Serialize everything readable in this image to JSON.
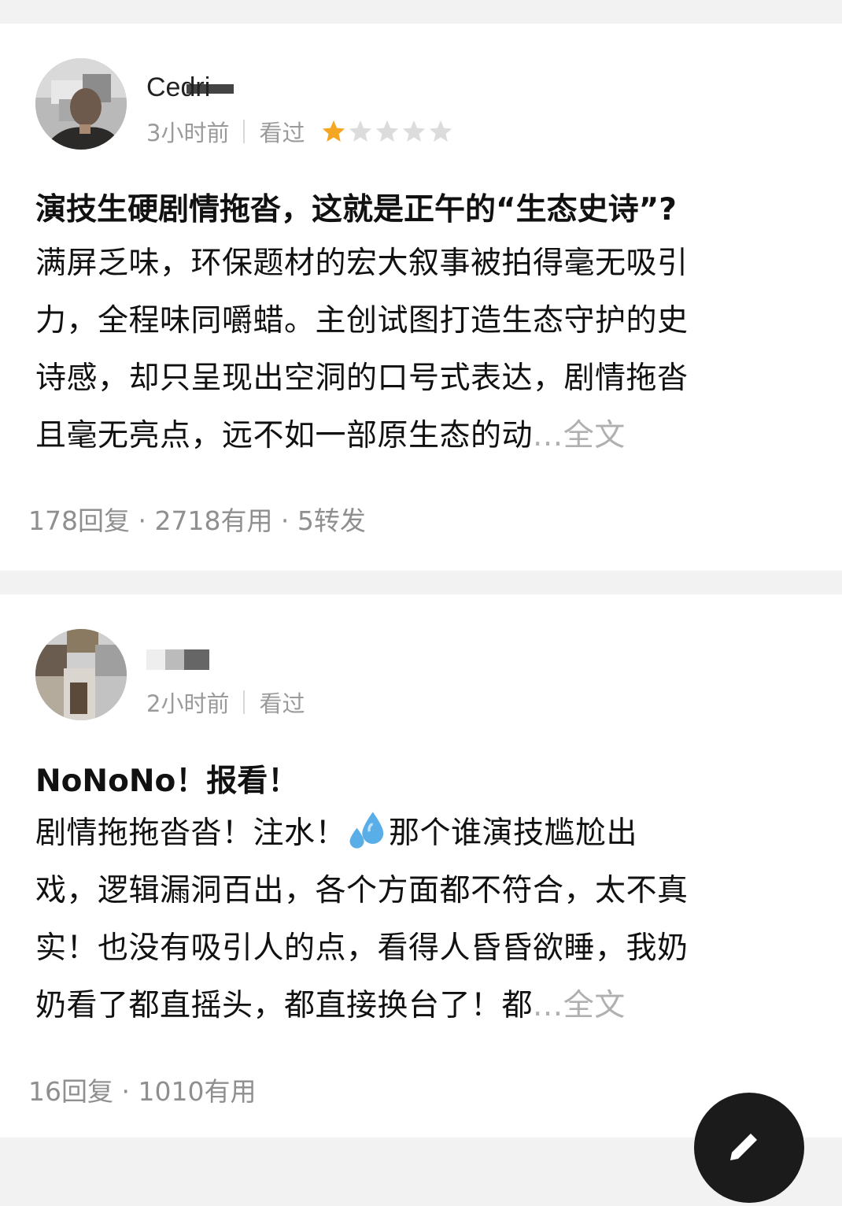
{
  "colors": {
    "page_bg": "#f2f2f2",
    "card_bg": "#ffffff",
    "muted_text": "#9a9a9a",
    "star_active": "#f5a623",
    "star_inactive": "#dcdcdc",
    "more_link": "#b0b0b0"
  },
  "reviews": [
    {
      "username": "Cedri",
      "time": "3小时前",
      "status": "看过",
      "rating": 1,
      "rating_max": 5,
      "title": "演技生硬剧情拖沓，这就是正午的“生态史诗”?",
      "body_lines": [
        "满屏乏味，环保题材的宏大叙事被拍得毫无吸引",
        "力，全程味同嚼蜡。主创试图打造生态守护的史",
        "诗感，却只呈现出空洞的口号式表达，剧情拖沓",
        "且毫无亮点，远不如一部原生态的动"
      ],
      "more_label": "...全文",
      "stats": "178回复 · 2718有用 · 5转发"
    },
    {
      "username": "",
      "time": "2小时前",
      "status": "看过",
      "title": "NoNoNo！报看！",
      "body_line1_a": "剧情拖拖沓沓！注水！",
      "icon_drop": "sweat-droplets-icon",
      "body_line1_b": "那个谁演技尴尬出",
      "body_lines": [
        "戏，逻辑漏洞百出，各个方面都不符合，太不真",
        "实！也没有吸引人的点，看得人昏昏欲睡，我奶",
        "奶看了都直摇头，都直接换台了！都"
      ],
      "more_label": "...全文",
      "stats": "16回复 · 1010有用"
    }
  ]
}
